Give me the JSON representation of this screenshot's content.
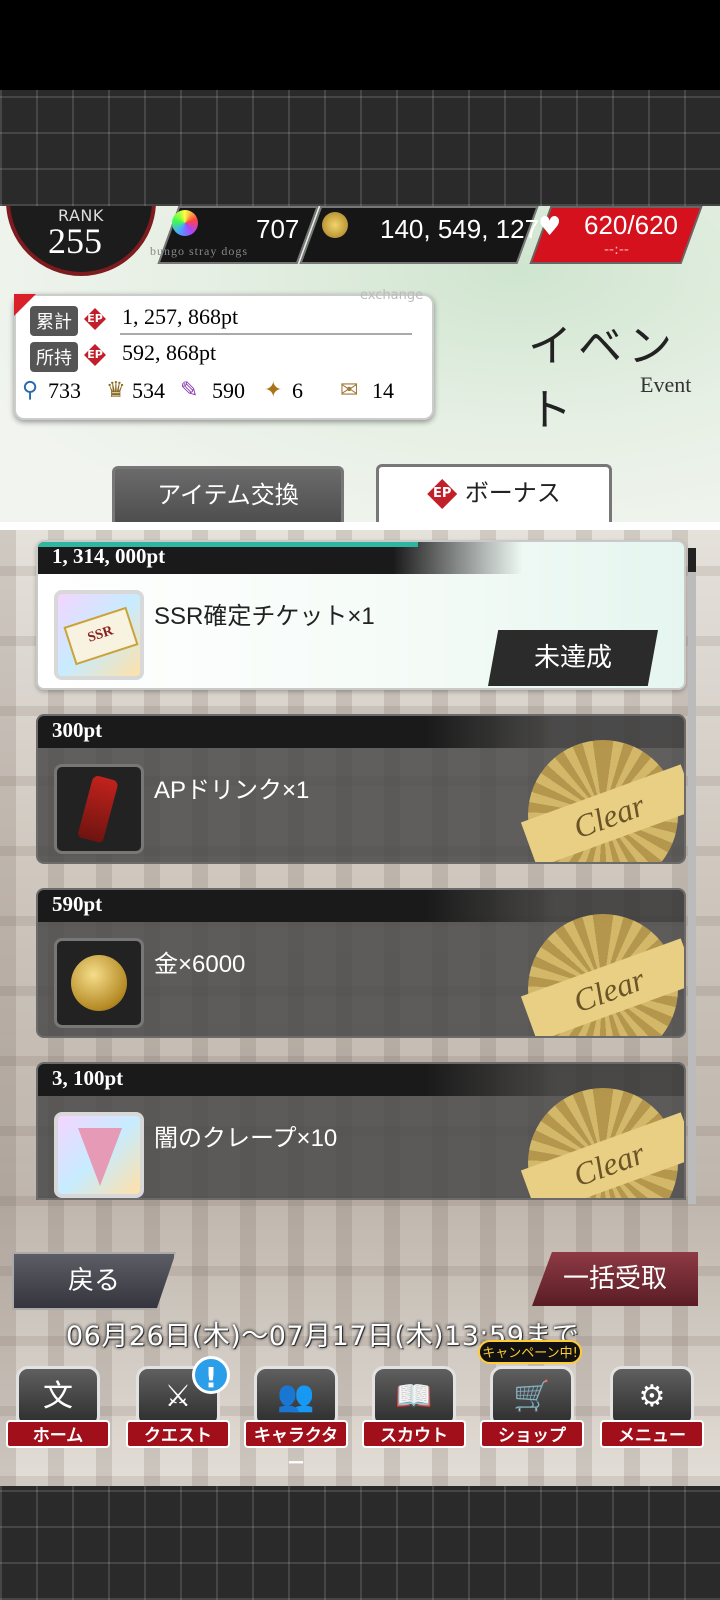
{
  "status": {
    "rank_label": "RANK",
    "rank_value": "255",
    "crystal_count": "707",
    "gold_count": "140, 549, 127",
    "hp": "620/620",
    "hp_timer": "--:--",
    "subtitle": "bungo stray dogs"
  },
  "ep_card": {
    "watermark": "exchange",
    "total_label": "累計",
    "total_value": "1, 257, 868pt",
    "owned_label": "所持",
    "owned_value": "592, 868pt",
    "ep_icon": "EP",
    "items": [
      {
        "icon": "key-icon",
        "value": "733"
      },
      {
        "icon": "trophy-icon",
        "value": "534"
      },
      {
        "icon": "quill-icon",
        "value": "590"
      },
      {
        "icon": "wand-icon",
        "value": "6"
      },
      {
        "icon": "envelope-icon",
        "value": "14"
      }
    ]
  },
  "page": {
    "title_jp": "イベント",
    "title_en": "Event"
  },
  "tabs": [
    {
      "label": "アイテム交換",
      "active": false
    },
    {
      "label": "ボーナス",
      "active": true,
      "icon": "EP"
    }
  ],
  "rewards": [
    {
      "pt": "1, 314, 000pt",
      "name": "SSR確定チケット×1",
      "status": "未達成",
      "icon": "ssr-ticket-icon"
    },
    {
      "pt": "300pt",
      "name": "APドリンク×1",
      "status": "Clear",
      "icon": "ap-drink-icon"
    },
    {
      "pt": "590pt",
      "name": "金×6000",
      "status": "Clear",
      "icon": "gold-coin-icon"
    },
    {
      "pt": "3, 100pt",
      "name": "闇のクレープ×10",
      "status": "Clear",
      "icon": "crepe-icon"
    }
  ],
  "buttons": {
    "back": "戻る",
    "receive_all": "一括受取"
  },
  "period": "06月26日(木)～07月17日(木)13:59まで",
  "campaign_badge": "キャンペーン中!",
  "nav": [
    {
      "label": "ホーム",
      "icon": "文"
    },
    {
      "label": "クエスト",
      "icon": "⚔"
    },
    {
      "label": "キャラクター",
      "icon": "👥"
    },
    {
      "label": "スカウト",
      "icon": "📖"
    },
    {
      "label": "ショップ",
      "icon": "🛒"
    },
    {
      "label": "メニュー",
      "icon": "⚙"
    }
  ],
  "colors": {
    "accent_red": "#d4111d",
    "teal": "#2fb6a0"
  }
}
